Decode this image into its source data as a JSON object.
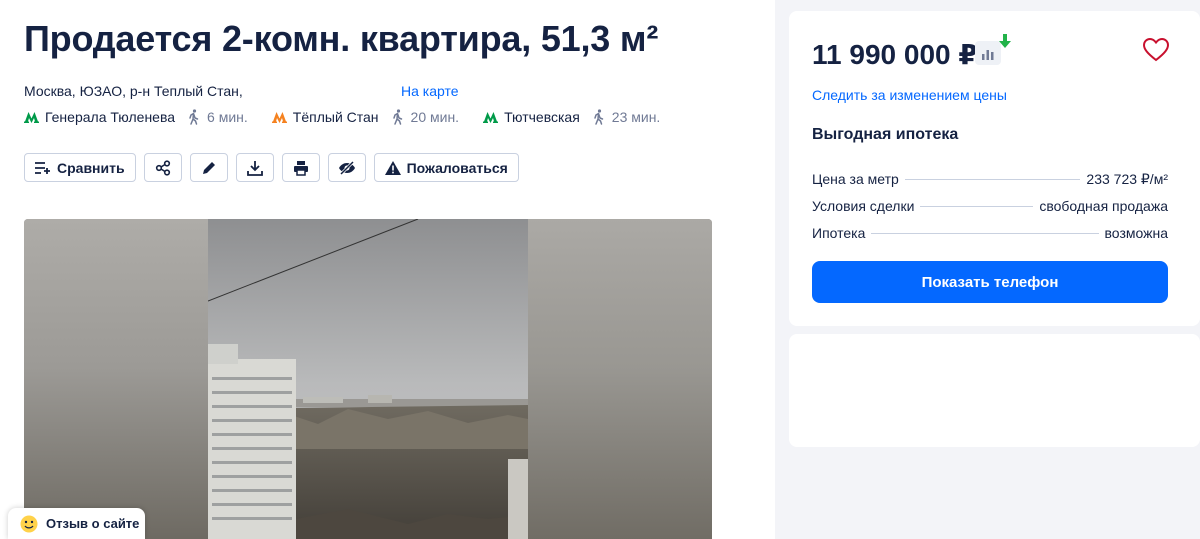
{
  "listing": {
    "title": "Продается 2-комн. квартира, 51,3 м²",
    "address": "Москва, ЮЗАО, р-н Теплый Стан,",
    "map_link": "На карте",
    "metro": [
      {
        "name": "Генерала Тюленева",
        "walk": "6 мин.",
        "color": "#009a49"
      },
      {
        "name": "Тёплый Стан",
        "walk": "20 мин.",
        "color": "#f58220"
      },
      {
        "name": "Тютчевская",
        "walk": "23 мин.",
        "color": "#009a49"
      }
    ]
  },
  "actions": {
    "compare_label": "Сравнить",
    "complain_label": "Пожаловаться",
    "icons": [
      "compare-icon",
      "share-icon",
      "edit-icon",
      "download-icon",
      "print-icon",
      "hide-icon",
      "warning-icon"
    ]
  },
  "feedback": {
    "label": "Отзыв о сайте"
  },
  "offer": {
    "price": "11 990 000 ₽",
    "follow_price": "Следить за изменением цены",
    "mortgage_title": "Выгодная ипотека",
    "params": [
      {
        "key": "Цена за метр",
        "value": "233 723 ₽/м²"
      },
      {
        "key": "Условия сделки",
        "value": "свободная продажа"
      },
      {
        "key": "Ипотека",
        "value": "возможна"
      }
    ],
    "phone_button": "Показать телефон"
  },
  "colors": {
    "accent": "#0468ff",
    "text": "#152242",
    "secondary": "#707a95",
    "favorite": "#c8102e",
    "price_down": "#22b34a"
  }
}
